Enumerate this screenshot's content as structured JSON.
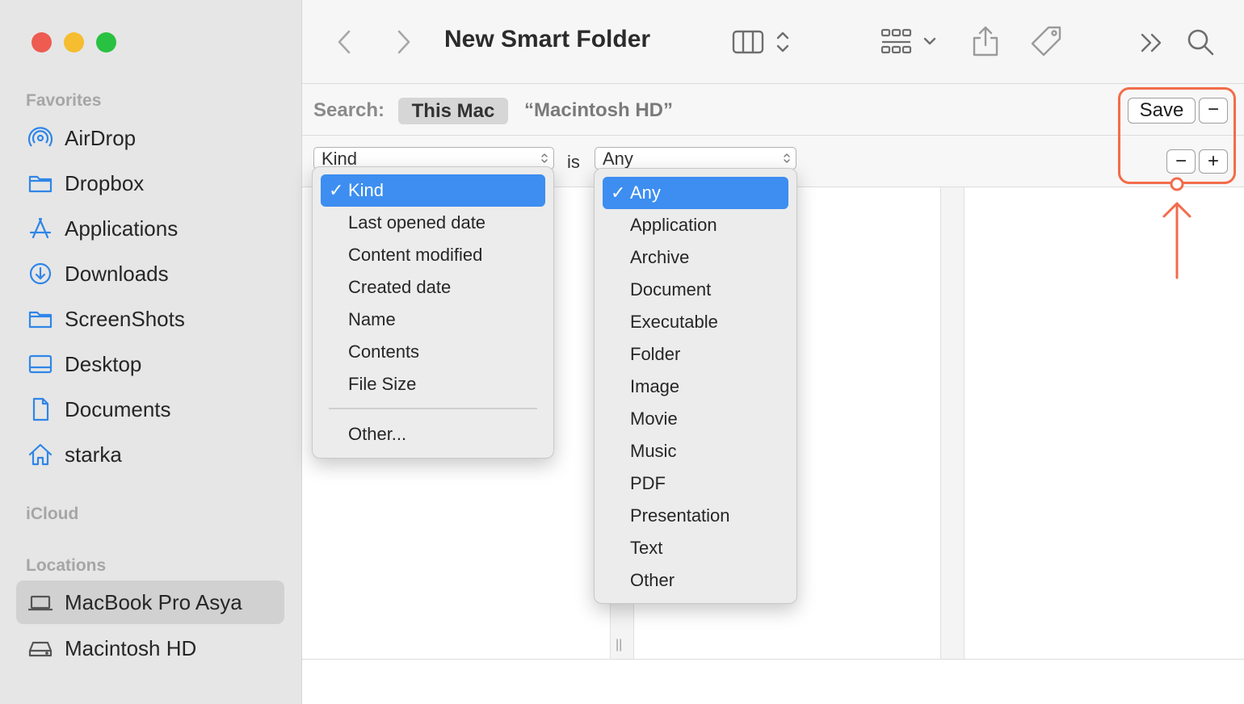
{
  "window": {
    "title": "New Smart Folder"
  },
  "sidebar": {
    "favorites_label": "Favorites",
    "icloud_label": "iCloud",
    "locations_label": "Locations",
    "favorites": [
      {
        "label": "AirDrop",
        "icon": "airdrop-icon"
      },
      {
        "label": "Dropbox",
        "icon": "folder-icon"
      },
      {
        "label": "Applications",
        "icon": "applications-icon"
      },
      {
        "label": "Downloads",
        "icon": "downloads-icon"
      },
      {
        "label": "ScreenShots",
        "icon": "folder-icon"
      },
      {
        "label": "Desktop",
        "icon": "desktop-icon"
      },
      {
        "label": "Documents",
        "icon": "document-icon"
      },
      {
        "label": "starka",
        "icon": "home-icon"
      }
    ],
    "locations": [
      {
        "label": "MacBook Pro Asya",
        "icon": "laptop-icon",
        "selected": true
      },
      {
        "label": "Macintosh HD",
        "icon": "disk-icon",
        "selected": false
      }
    ]
  },
  "search": {
    "label": "Search:",
    "scope_selected": "This Mac",
    "scope_other": "“Macintosh HD”",
    "save_label": "Save",
    "remove_symbol": "−"
  },
  "criteria": {
    "attribute_value": "Kind",
    "operator": "is",
    "kind_value": "Any",
    "remove_symbol": "−",
    "add_symbol": "+"
  },
  "attribute_menu": {
    "items": [
      "Kind",
      "Last opened date",
      "Content modified",
      "Created date",
      "Name",
      "Contents",
      "File Size"
    ],
    "checked_index": 0,
    "other": "Other..."
  },
  "kind_menu": {
    "items": [
      "Any",
      "Application",
      "Archive",
      "Document",
      "Executable",
      "Folder",
      "Image",
      "Movie",
      "Music",
      "PDF",
      "Presentation",
      "Text",
      "Other"
    ],
    "checked_index": 0
  },
  "colors": {
    "accent": "#3d8ef0",
    "annotation": "#f26c4a",
    "sidebar_bg": "#e6e6e6",
    "traffic_red": "#ed5b51",
    "traffic_yellow": "#f5bd2f",
    "traffic_green": "#29c141"
  },
  "glyphs": {
    "check": "✓",
    "column_resizer": "||"
  }
}
